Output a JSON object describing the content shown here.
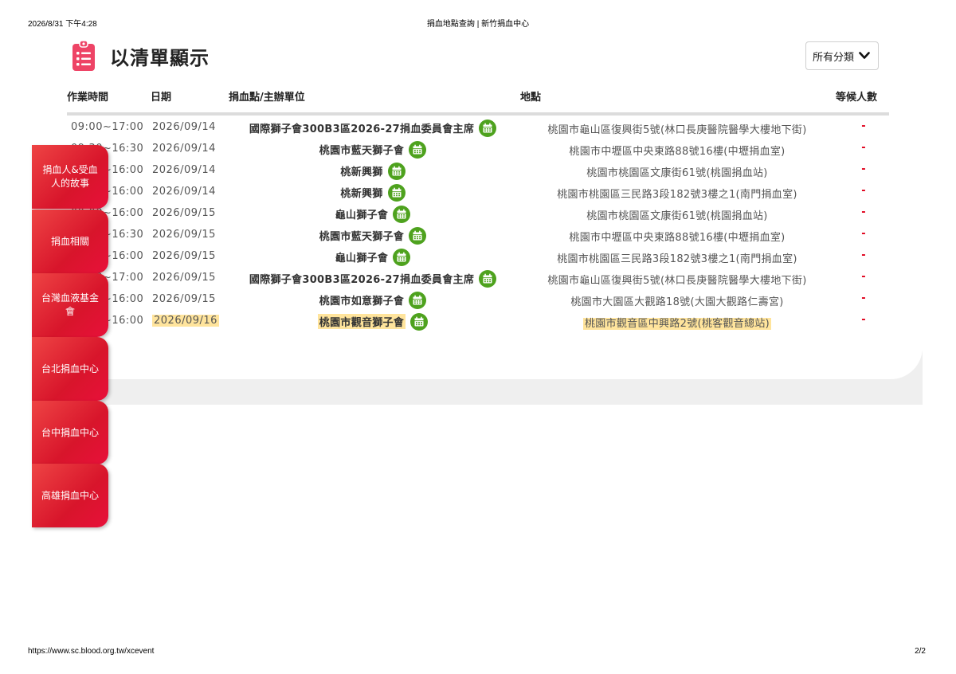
{
  "print_header": {
    "datetime": "2026/8/31 下午4:28",
    "page_title": "捐血地點查詢 | 新竹捐血中心"
  },
  "print_footer": {
    "url": "https://www.sc.blood.org.tw/xcevent",
    "page": "2/2"
  },
  "title": "以清單顯示",
  "title_icon": "clipboard-list-icon",
  "category_filter": {
    "value": "所有分類",
    "icon": "chevron-down-icon"
  },
  "table": {
    "headers": {
      "time": "作業時間",
      "date": "日期",
      "org": "捐血點/主辦單位",
      "location": "地點",
      "waiting": "等候人數"
    },
    "rows": [
      {
        "time": "09:00~17:00",
        "date": "2026/09/14",
        "org": "國際獅子會300B3區2026-27捐血委員會主席",
        "location": "桃園市龜山區復興街5號(林口長庚醫院醫學大樓地下街)",
        "waiting": "-",
        "highlight": false
      },
      {
        "time": "09:30~16:30",
        "date": "2026/09/14",
        "org": "桃園市藍天獅子會",
        "location": "桃園市中壢區中央東路88號16樓(中壢捐血室)",
        "waiting": "-",
        "highlight": false
      },
      {
        "time": "09:00~16:00",
        "date": "2026/09/14",
        "org": "桃新興獅",
        "location": "桃園市桃園區文康街61號(桃園捐血站)",
        "waiting": "-",
        "highlight": false
      },
      {
        "time": "09:00~16:00",
        "date": "2026/09/14",
        "org": "桃新興獅",
        "location": "桃園市桃園區三民路3段182號3樓之1(南門捐血室)",
        "waiting": "-",
        "highlight": false
      },
      {
        "time": "09:00~16:00",
        "date": "2026/09/15",
        "org": "龜山獅子會",
        "location": "桃園市桃園區文康街61號(桃園捐血站)",
        "waiting": "-",
        "highlight": false
      },
      {
        "time": "09:30~16:30",
        "date": "2026/09/15",
        "org": "桃園市藍天獅子會",
        "location": "桃園市中壢區中央東路88號16樓(中壢捐血室)",
        "waiting": "-",
        "highlight": false
      },
      {
        "time": "09:00~16:00",
        "date": "2026/09/15",
        "org": "龜山獅子會",
        "location": "桃園市桃園區三民路3段182號3樓之1(南門捐血室)",
        "waiting": "-",
        "highlight": false
      },
      {
        "time": "09:00~17:00",
        "date": "2026/09/15",
        "org": "國際獅子會300B3區2026-27捐血委員會主席",
        "location": "桃園市龜山區復興街5號(林口長庚醫院醫學大樓地下街)",
        "waiting": "-",
        "highlight": false
      },
      {
        "time": "09:00~16:00",
        "date": "2026/09/15",
        "org": "桃園市如意獅子會",
        "location": "桃園市大園區大觀路18號(大園大觀路仁壽宮)",
        "waiting": "-",
        "highlight": false
      },
      {
        "time": "09:00~16:00",
        "date": "2026/09/16",
        "org": "桃園市觀音獅子會",
        "location": "桃園市觀音區中興路2號(桃客觀音總站)",
        "waiting": "-",
        "highlight": true
      }
    ],
    "row_icon": "calendar-icon"
  },
  "side_tabs": [
    "捐血人&受血人的故事",
    "捐血相關",
    "台灣血液基金會",
    "台北捐血中心",
    "台中捐血中心",
    "高雄捐血中心"
  ],
  "colors": {
    "accent_red": "#d8152b",
    "calendar_green": "#4ea21e",
    "highlight": "#ffe49c",
    "icon_pink": "#ee4466"
  }
}
